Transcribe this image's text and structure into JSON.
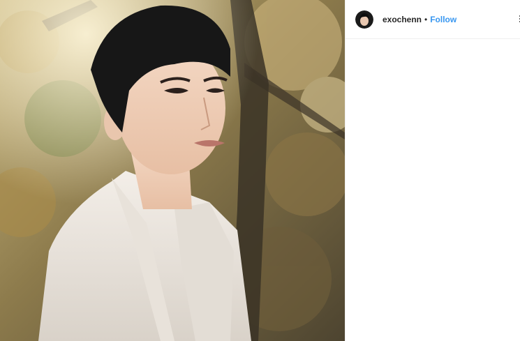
{
  "post": {
    "username": "exochenn",
    "separator": "•",
    "follow_label": "Follow"
  },
  "icons": {
    "avatar": "profile-avatar",
    "more": "more-options-icon"
  },
  "colors": {
    "follow": "#3897f0",
    "text": "#262626",
    "border": "#efefef"
  }
}
